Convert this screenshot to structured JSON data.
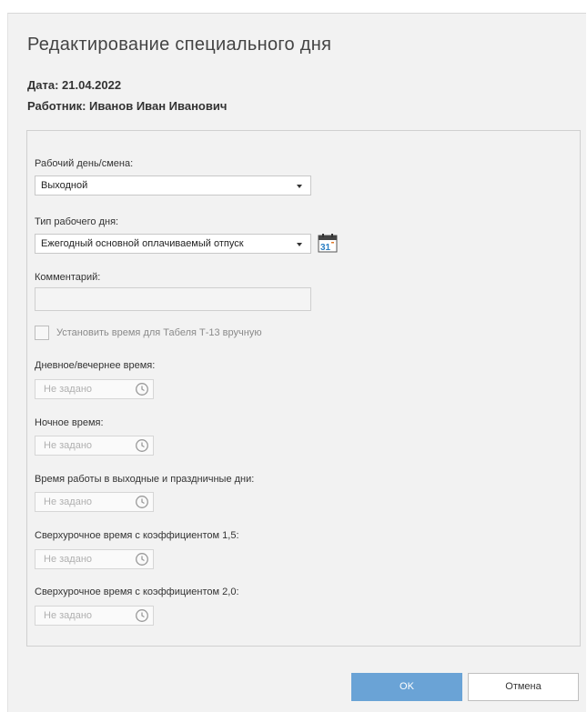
{
  "dialog": {
    "title": "Редактирование специального дня",
    "date_line": "Дата: 21.04.2022",
    "employee_line": "Работник: Иванов Иван Иванович"
  },
  "form": {
    "workday_label": "Рабочий день/смена:",
    "workday_value": "Выходной",
    "daytype_label": "Тип рабочего дня:",
    "daytype_value": "Ежегодный основной оплачиваемый отпуск",
    "calendar_icon_text": "31",
    "comment_label": "Комментарий:",
    "comment_value": "",
    "manual_checkbox_label": "Установить время для Табеля Т-13 вручную",
    "manual_checkbox_checked": false,
    "time_fields": [
      {
        "label": "Дневное/вечернее время:",
        "placeholder": "Не задано"
      },
      {
        "label": "Ночное время:",
        "placeholder": "Не задано"
      },
      {
        "label": "Время работы в выходные и праздничные дни:",
        "placeholder": "Не задано"
      },
      {
        "label": "Сверхурочное время с коэффициентом 1,5:",
        "placeholder": "Не задано"
      },
      {
        "label": "Сверхурочное время с коэффициентом 2,0:",
        "placeholder": "Не задано"
      }
    ]
  },
  "buttons": {
    "ok": "OK",
    "cancel": "Отмена"
  },
  "colors": {
    "primary": "#6aa3d6",
    "background": "#f2f2f2",
    "border": "#d0d0d0",
    "calendar_accent": "#2a7fc4"
  }
}
